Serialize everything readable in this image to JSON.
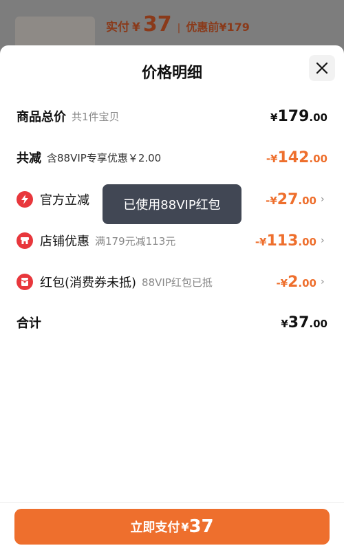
{
  "behind": {
    "paid_label": "实付",
    "paid_currency": "¥",
    "paid_amount": "37",
    "separator": "|",
    "before_label": "优惠前¥179"
  },
  "sheet": {
    "title": "价格明细"
  },
  "rows": {
    "total": {
      "name": "商品总价",
      "sub": "共1件宝贝",
      "prefix": "",
      "currency": "¥",
      "int": "179",
      "dec": ".00"
    },
    "reduction": {
      "name": "共减",
      "sub": "含88VIP专享优惠￥2.00",
      "prefix": "-",
      "currency": "¥",
      "int": "142",
      "dec": ".00"
    },
    "official": {
      "name": "官方立减",
      "sub": "",
      "prefix": "-",
      "currency": "¥",
      "int": "27",
      "dec": ".00"
    },
    "store": {
      "name": "店铺优惠",
      "sub": "满179元减113元",
      "prefix": "-",
      "currency": "¥",
      "int": "113",
      "dec": ".00"
    },
    "redpacket": {
      "name": "红包(消费券未抵)",
      "sub": "88VIP红包已抵",
      "prefix": "-",
      "currency": "¥",
      "int": "2",
      "dec": ".00"
    },
    "sum": {
      "name": "合计",
      "prefix": "",
      "currency": "¥",
      "int": "37",
      "dec": ".00"
    }
  },
  "tooltip": {
    "text": "已使用88VIP红包"
  },
  "pay_button": {
    "label": "立即支付",
    "currency": "¥",
    "amount": "37"
  },
  "icons": {
    "official": "lightning-icon",
    "store": "store-icon",
    "redpacket": "red-packet-icon",
    "chevron": "chevron-right-icon",
    "close": "close-icon"
  },
  "colors": {
    "accent": "#ee6f2d",
    "icon_red": "#e8373c",
    "tooltip_bg": "#414754"
  }
}
